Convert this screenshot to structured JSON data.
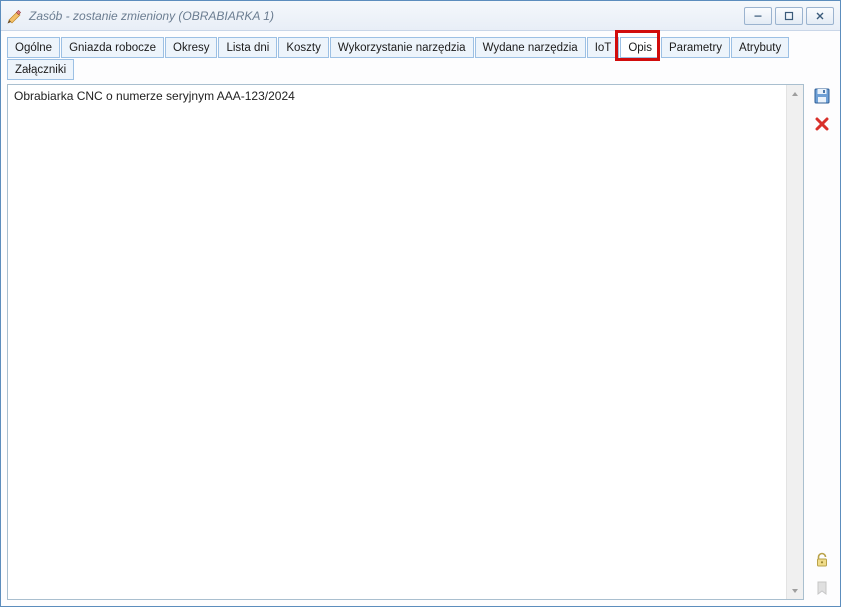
{
  "window": {
    "title": "Zasób - zostanie zmieniony  (OBRABIARKA 1)"
  },
  "tabs": [
    {
      "id": "ogolne",
      "label": "Ogólne",
      "active": false
    },
    {
      "id": "gniazda",
      "label": "Gniazda robocze",
      "active": false
    },
    {
      "id": "okresy",
      "label": "Okresy",
      "active": false
    },
    {
      "id": "lista-dni",
      "label": "Lista dni",
      "active": false
    },
    {
      "id": "koszty",
      "label": "Koszty",
      "active": false
    },
    {
      "id": "wykorzystanie",
      "label": "Wykorzystanie narzędzia",
      "active": false
    },
    {
      "id": "wydane",
      "label": "Wydane narzędzia",
      "active": false
    },
    {
      "id": "iot",
      "label": "IoT",
      "active": false
    },
    {
      "id": "opis",
      "label": "Opis",
      "active": true
    },
    {
      "id": "parametry",
      "label": "Parametry",
      "active": false
    },
    {
      "id": "atrybuty",
      "label": "Atrybuty",
      "active": false
    },
    {
      "id": "zalaczniki",
      "label": "Załączniki",
      "active": false
    }
  ],
  "content": {
    "description_text": "Obrabiarka CNC o numerze seryjnym AAA-123/2024"
  },
  "highlight": {
    "target_tab_id": "opis"
  }
}
